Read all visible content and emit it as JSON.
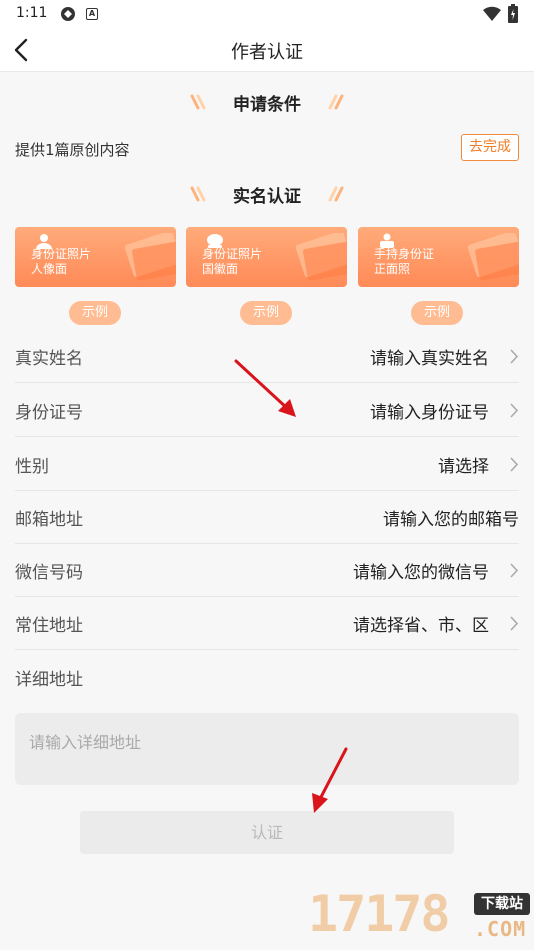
{
  "status_bar": {
    "time": "1:11",
    "app_badge": "A"
  },
  "nav": {
    "title": "作者认证"
  },
  "conditions": {
    "section_title": "申请条件",
    "requirement": "提供1篇原创内容",
    "action_label": "去完成"
  },
  "real_name": {
    "section_title": "实名认证",
    "cards": [
      {
        "label": "身份证照片\n人像面",
        "icon": "person-icon",
        "example_label": "示例"
      },
      {
        "label": "身份证照片\n国徽面",
        "icon": "emblem-icon",
        "example_label": "示例"
      },
      {
        "label": "手持身份证\n正面照",
        "icon": "hand-id-icon",
        "example_label": "示例"
      }
    ]
  },
  "form": {
    "rows": [
      {
        "label": "真实姓名",
        "value": "请输入真实姓名",
        "arrow": true
      },
      {
        "label": "身份证号",
        "value": "请输入身份证号",
        "arrow": true
      },
      {
        "label": "性别",
        "value": "请选择",
        "arrow": true
      },
      {
        "label": "邮箱地址",
        "value": "请输入您的邮箱号",
        "arrow": false
      },
      {
        "label": "微信号码",
        "value": "请输入您的微信号",
        "arrow": true
      },
      {
        "label": "常住地址",
        "value": "请选择省、市、区",
        "arrow": true
      }
    ],
    "address_label": "详细地址",
    "address_placeholder": "请输入详细地址"
  },
  "submit_label": "认证",
  "watermark": {
    "digits": "17178",
    "tag": "下载站",
    "domain": ".COM"
  },
  "colors": {
    "accent": "#ef7d2a",
    "card_gradient_top": "#ffab7a",
    "card_gradient_bottom": "#ff8a57",
    "annotation_arrow": "#d9141b"
  }
}
